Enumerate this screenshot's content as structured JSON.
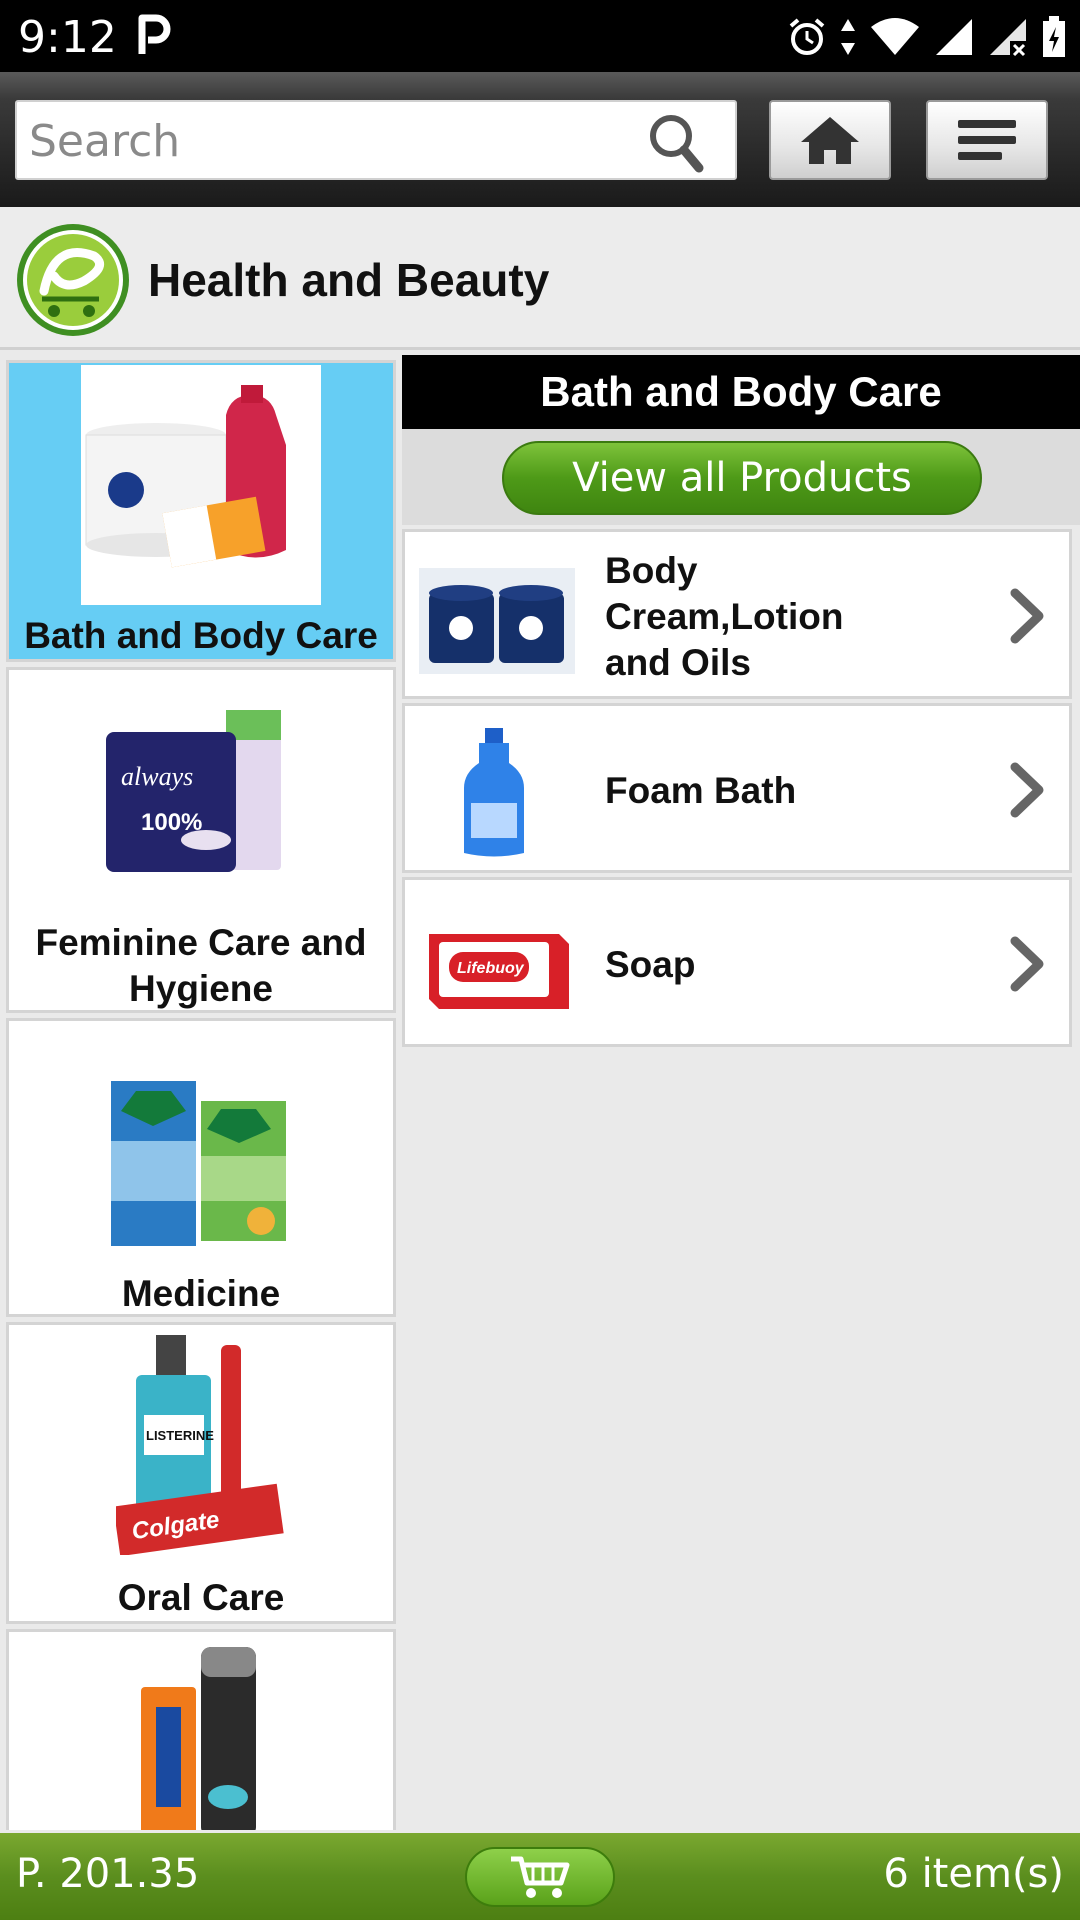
{
  "status_bar": {
    "time": "9:12"
  },
  "toolbar": {
    "search_placeholder": "Search"
  },
  "header": {
    "title": "Health and Beauty"
  },
  "categories": [
    {
      "label": "Bath and Body Care",
      "selected": true
    },
    {
      "label": "Feminine Care and Hygiene"
    },
    {
      "label": "Medicine"
    },
    {
      "label": "Oral Care"
    },
    {
      "label": ""
    }
  ],
  "subcategory_panel": {
    "title": "Bath and Body Care",
    "view_all_label": "View all Products",
    "items": [
      {
        "label": "Body Cream,Lotion and Oils"
      },
      {
        "label": "Foam Bath"
      },
      {
        "label": "Soap"
      }
    ]
  },
  "footer": {
    "total": "P. 201.35",
    "item_count": "6 item(s)"
  },
  "colors": {
    "selected_bg": "#66cdf4",
    "accent_green": "#4e9a18"
  }
}
